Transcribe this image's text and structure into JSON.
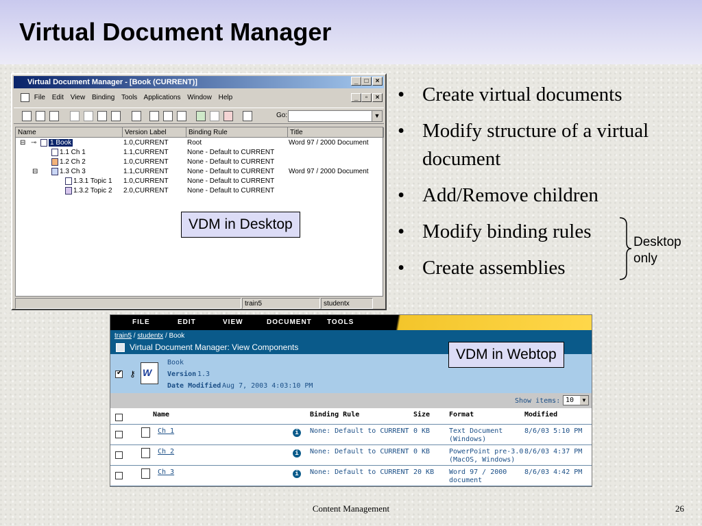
{
  "slide": {
    "title": "Virtual Document Manager",
    "footer": "Content Management",
    "page_number": "26"
  },
  "desktop": {
    "window_title": "Virtual Document Manager - [Book (CURRENT)]",
    "menu": [
      "File",
      "Edit",
      "View",
      "Binding",
      "Tools",
      "Applications",
      "Window",
      "Help"
    ],
    "go_label": "Go:",
    "columns": [
      "Name",
      "Version Label",
      "Binding Rule",
      "Title"
    ],
    "rows": [
      {
        "name": "1 Book",
        "version": "1.0,CURRENT",
        "rule": "Root",
        "title": "Word 97 / 2000 Document"
      },
      {
        "name": "1.1 Ch 1",
        "version": "1.1,CURRENT",
        "rule": "None - Default to CURRENT",
        "title": ""
      },
      {
        "name": "1.2 Ch 2",
        "version": "1.0,CURRENT",
        "rule": "None - Default to CURRENT",
        "title": ""
      },
      {
        "name": "1.3 Ch 3",
        "version": "1.1,CURRENT",
        "rule": "None - Default to CURRENT",
        "title": "Word 97 / 2000 Document"
      },
      {
        "name": "1.3.1 Topic 1",
        "version": "1.0,CURRENT",
        "rule": "None - Default to CURRENT",
        "title": ""
      },
      {
        "name": "1.3.2 Topic 2",
        "version": "2.0,CURRENT",
        "rule": "None - Default to CURRENT",
        "title": ""
      }
    ],
    "status": [
      "train5",
      "studentx"
    ],
    "callout": "VDM in Desktop"
  },
  "bullets": [
    "Create virtual documents",
    "Modify structure of a virtual document",
    "Add/Remove children",
    "Modify binding rules",
    "Create assemblies"
  ],
  "desktop_only_note": "Desktop only",
  "webtop": {
    "menu": [
      "FILE",
      "EDIT",
      "VIEW",
      "DOCUMENT",
      "TOOLS"
    ],
    "crumb": {
      "c1": "train5",
      "sep": " / ",
      "c2": "studentx",
      "c3": " / Book"
    },
    "title": "Virtual Document Manager: View Components",
    "doc_name": "Book",
    "version_label": "Version",
    "version_value": "1.3",
    "date_label": "Date Modified",
    "date_value": "Aug 7, 2003 4:03:10 PM",
    "show_items_label": "Show items:",
    "show_items_value": "10",
    "columns": [
      "Name",
      "Binding Rule",
      "Size",
      "Format",
      "Modified"
    ],
    "rows": [
      {
        "name": "Ch 1",
        "rule": "None: Default to CURRENT",
        "size": "0 KB",
        "format1": "Text Document",
        "format2": "(Windows)",
        "modified": "8/6/03 5:10 PM"
      },
      {
        "name": "Ch 2",
        "rule": "None: Default to CURRENT",
        "size": "0 KB",
        "format1": "PowerPoint pre-3.0",
        "format2": "(MacOS, Windows)",
        "modified": "8/6/03 4:37 PM"
      },
      {
        "name": "Ch 3",
        "rule": "None: Default to CURRENT",
        "size": "20 KB",
        "format1": "Word 97 / 2000",
        "format2": "document",
        "modified": "8/6/03 4:42 PM"
      }
    ],
    "callout": "VDM in Webtop"
  }
}
